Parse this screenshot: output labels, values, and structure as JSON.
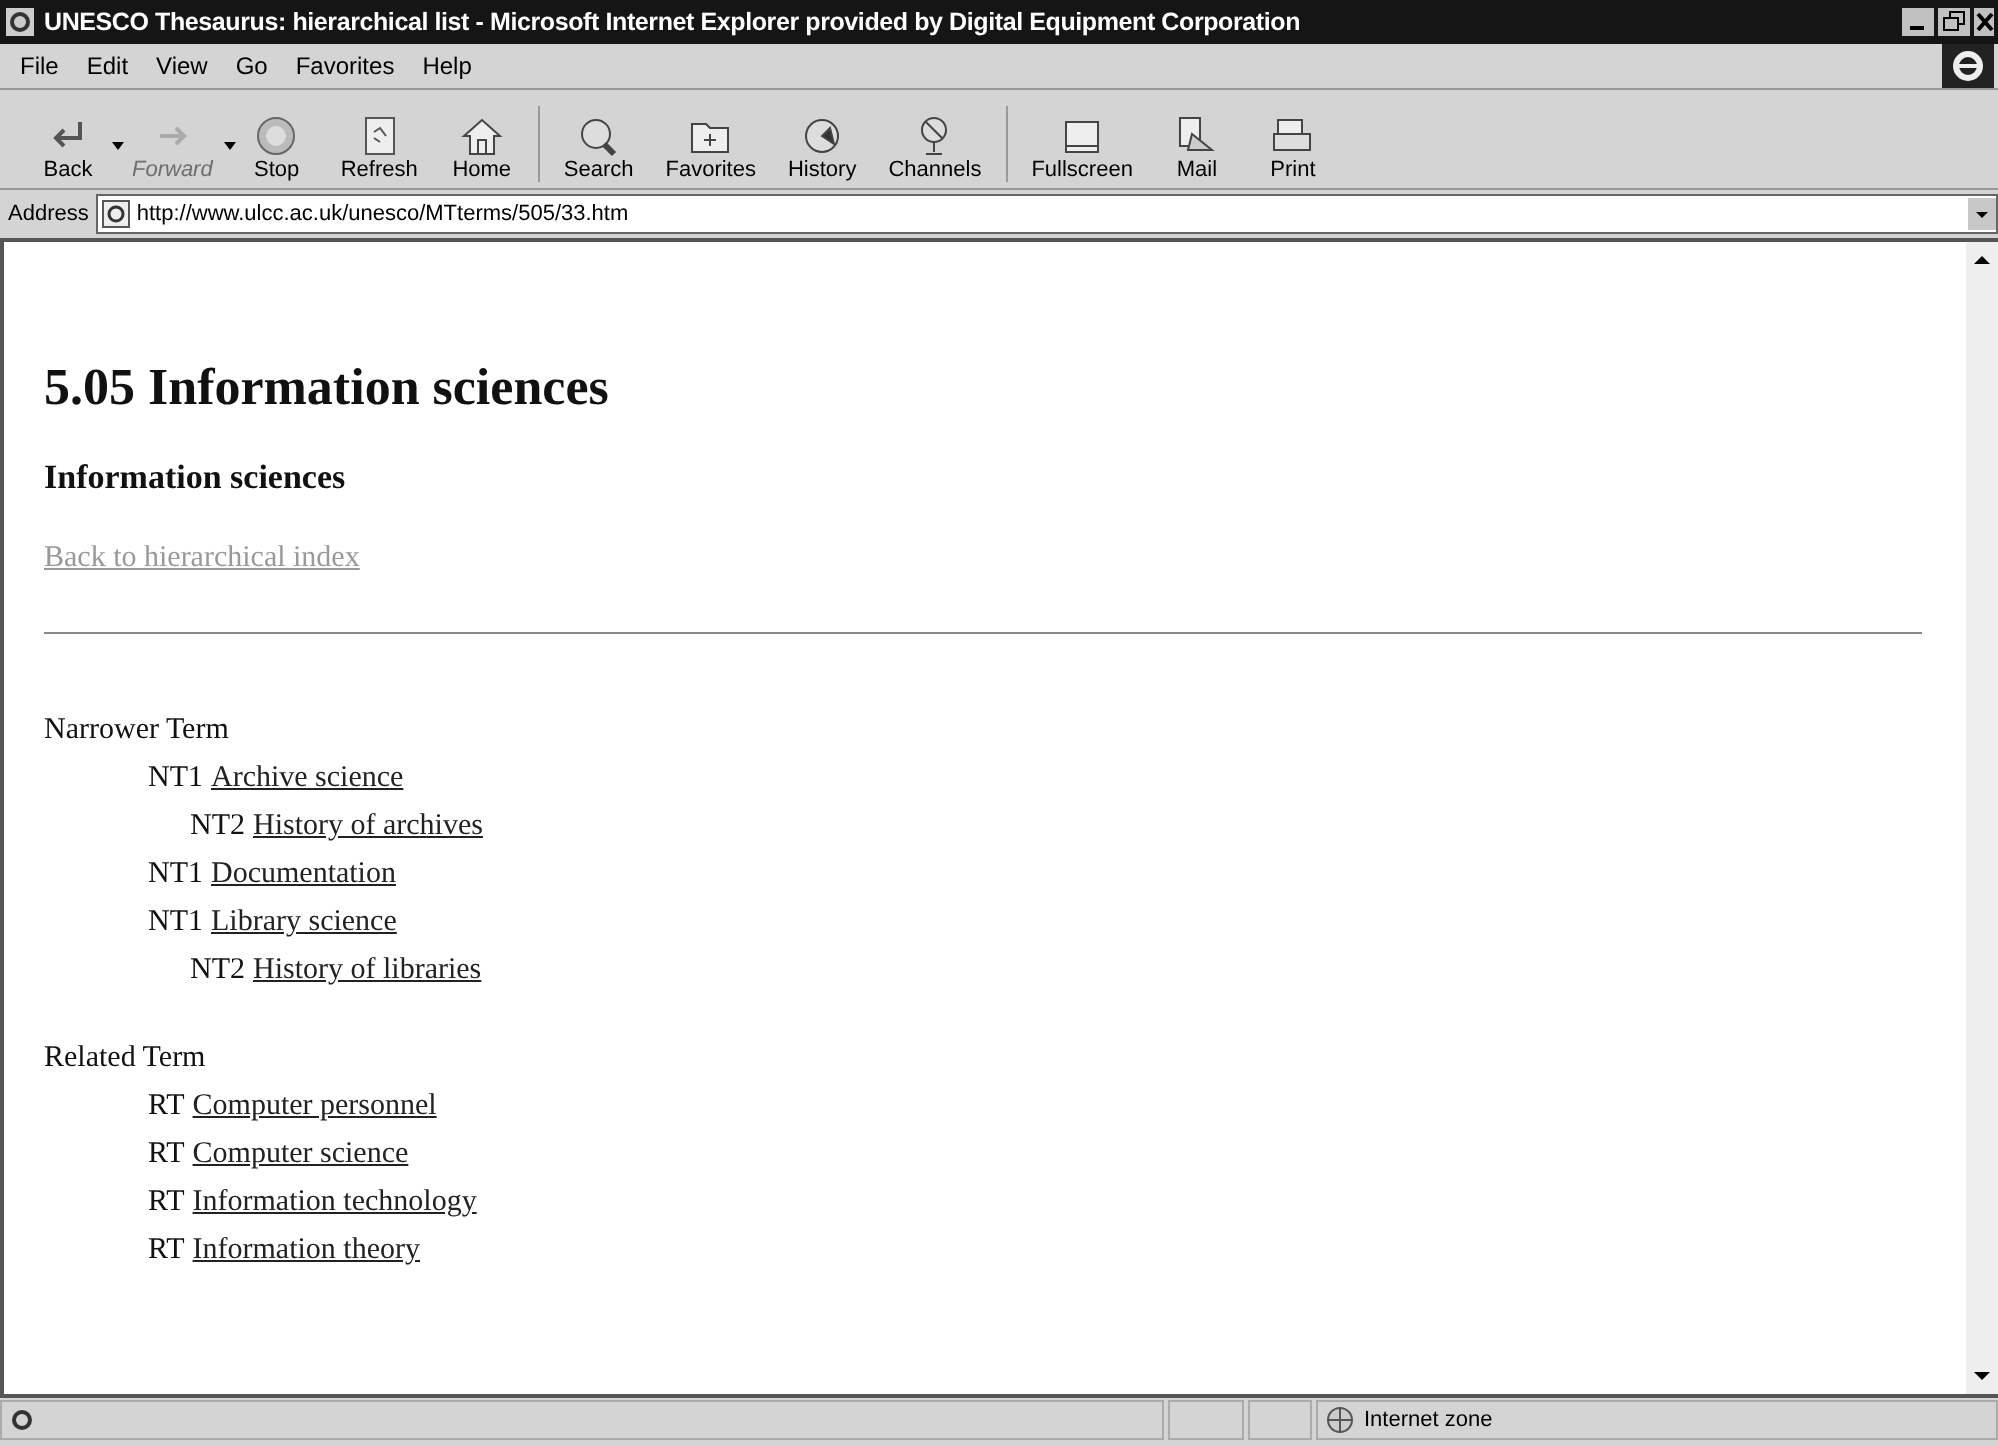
{
  "window": {
    "title": "UNESCO Thesaurus: hierarchical list - Microsoft Internet Explorer provided by Digital Equipment Corporation"
  },
  "menu": [
    "File",
    "Edit",
    "View",
    "Go",
    "Favorites",
    "Help"
  ],
  "toolbar": [
    {
      "kind": "back",
      "label": "Back",
      "disabled": false,
      "dropdown": true
    },
    {
      "kind": "forward",
      "label": "Forward",
      "disabled": true,
      "dropdown": true
    },
    {
      "kind": "stop",
      "label": "Stop",
      "disabled": false,
      "dropdown": false
    },
    {
      "kind": "refresh",
      "label": "Refresh",
      "disabled": false,
      "dropdown": false
    },
    {
      "kind": "home",
      "label": "Home",
      "disabled": false,
      "dropdown": false
    },
    {
      "kind": "search",
      "label": "Search",
      "disabled": false,
      "dropdown": false
    },
    {
      "kind": "favorites",
      "label": "Favorites",
      "disabled": false,
      "dropdown": false
    },
    {
      "kind": "history",
      "label": "History",
      "disabled": false,
      "dropdown": false
    },
    {
      "kind": "channels",
      "label": "Channels",
      "disabled": false,
      "dropdown": false
    },
    {
      "kind": "fullscreen",
      "label": "Fullscreen",
      "disabled": false,
      "dropdown": false
    },
    {
      "kind": "mail",
      "label": "Mail",
      "disabled": false,
      "dropdown": false
    },
    {
      "kind": "print",
      "label": "Print",
      "disabled": false,
      "dropdown": false
    }
  ],
  "address": {
    "label": "Address",
    "value": "http://www.ulcc.ac.uk/unesco/MTterms/505/33.htm"
  },
  "page": {
    "title": "5.05 Information sciences",
    "subtitle": "Information sciences",
    "back_link": "Back to hierarchical index",
    "sections": [
      {
        "heading": "Narrower Term",
        "items": [
          {
            "prefix": "NT1",
            "term": "Archive science",
            "children": [
              {
                "prefix": "NT2",
                "term": "History of archives"
              }
            ]
          },
          {
            "prefix": "NT1",
            "term": "Documentation"
          },
          {
            "prefix": "NT1",
            "term": "Library science",
            "children": [
              {
                "prefix": "NT2",
                "term": "History of libraries"
              }
            ]
          }
        ]
      },
      {
        "heading": "Related Term",
        "items": [
          {
            "prefix": "RT",
            "term": "Computer personnel"
          },
          {
            "prefix": "RT",
            "term": "Computer science"
          },
          {
            "prefix": "RT",
            "term": "Information technology"
          },
          {
            "prefix": "RT",
            "term": "Information theory"
          }
        ]
      }
    ]
  },
  "status_bar": {
    "zone": "Internet zone"
  }
}
